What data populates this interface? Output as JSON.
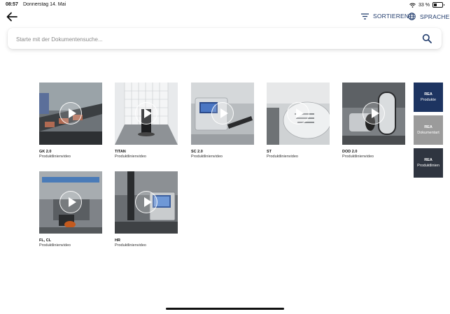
{
  "status": {
    "time": "08:57",
    "date": "Donnerstag 14. Mai",
    "battery": "33 %"
  },
  "toolbar": {
    "sort_label": "SORTIEREN",
    "language_label": "SPRACHE"
  },
  "search": {
    "placeholder": "Starte mit der Dokumentensuche..."
  },
  "videos": [
    {
      "title": "GK 2.0",
      "subtitle": "Produktlinienvideo"
    },
    {
      "title": "TITAN",
      "subtitle": "Produktlinienvideo"
    },
    {
      "title": "SC 2.0",
      "subtitle": "Produktlinienvideo"
    },
    {
      "title": "ST",
      "subtitle": "Produktlinienvideo"
    },
    {
      "title": "DOD 2.0",
      "subtitle": "Produktlinienvideo"
    },
    {
      "title": "FL, CL",
      "subtitle": "Produktlinienvideo"
    },
    {
      "title": "HR",
      "subtitle": "Produktlinienvideo"
    }
  ],
  "filters": [
    {
      "title": "REA",
      "subtitle": "Produkte",
      "color": "#1d3461"
    },
    {
      "title": "REA",
      "subtitle": "Dokumentart",
      "color": "#9b9b9b"
    },
    {
      "title": "REA",
      "subtitle": "Produktlinien",
      "color": "#2f3540"
    }
  ],
  "colors": {
    "accent": "#1f3a6b"
  }
}
